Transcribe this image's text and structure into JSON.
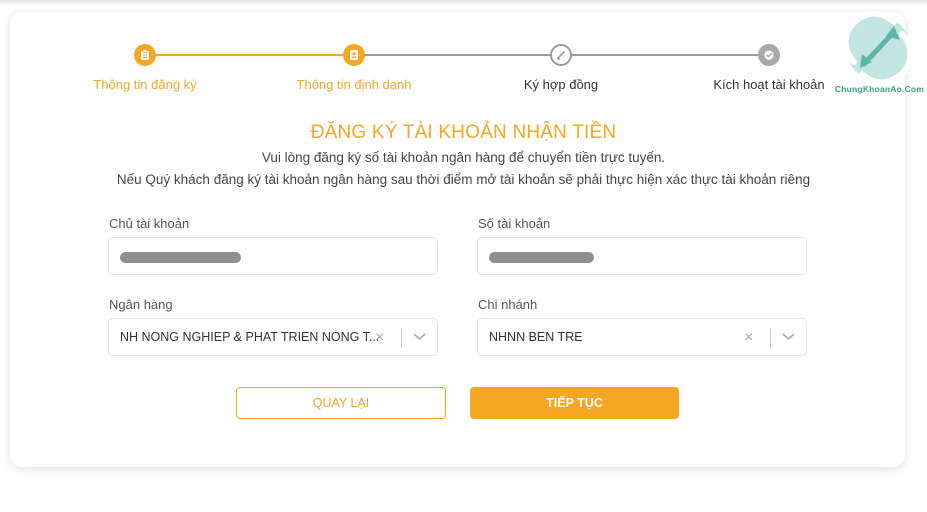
{
  "stepper": {
    "steps": [
      {
        "label": "Thông tin đăng ký",
        "status": "done",
        "icon": "clipboard-icon"
      },
      {
        "label": "Thông tin định danh",
        "status": "current",
        "icon": "id-card-icon"
      },
      {
        "label": "Ký hợp đồng",
        "status": "todo",
        "icon": "pen-icon"
      },
      {
        "label": "Kích hoạt tài khoản",
        "status": "todo",
        "icon": "check-badge-icon"
      }
    ]
  },
  "form": {
    "title": "ĐĂNG KÝ TÀI KHOẢN NHẬN TIỀN",
    "subtitle_1": "Vui lòng đăng ký số tài khoản ngân hàng để chuyển tiền trực tuyến.",
    "subtitle_2": "Nếu Quý khách đăng ký tài khoản ngân hàng sau thời điểm mở tài khoản sẽ phải thực hiện xác thực tài khoản riêng",
    "account_holder": {
      "label": "Chủ tài khoản",
      "value": "redacted"
    },
    "account_number": {
      "label": "Số tài khoản",
      "value": "redacted"
    },
    "bank": {
      "label": "Ngân hàng",
      "value": "NH NONG NGHIEP & PHAT TRIEN NONG T..."
    },
    "branch": {
      "label": "Chi nhánh",
      "value": "NHNN BEN TRE"
    },
    "clear_glyph": "×"
  },
  "buttons": {
    "back": "QUAY LẠI",
    "next": "TIẾP TỤC"
  },
  "watermark": {
    "text": "ChungKhoanAo.Com"
  },
  "colors": {
    "accent": "#f5a623",
    "inactive": "#9a9a9a",
    "watermark": "#3a9c8e"
  }
}
